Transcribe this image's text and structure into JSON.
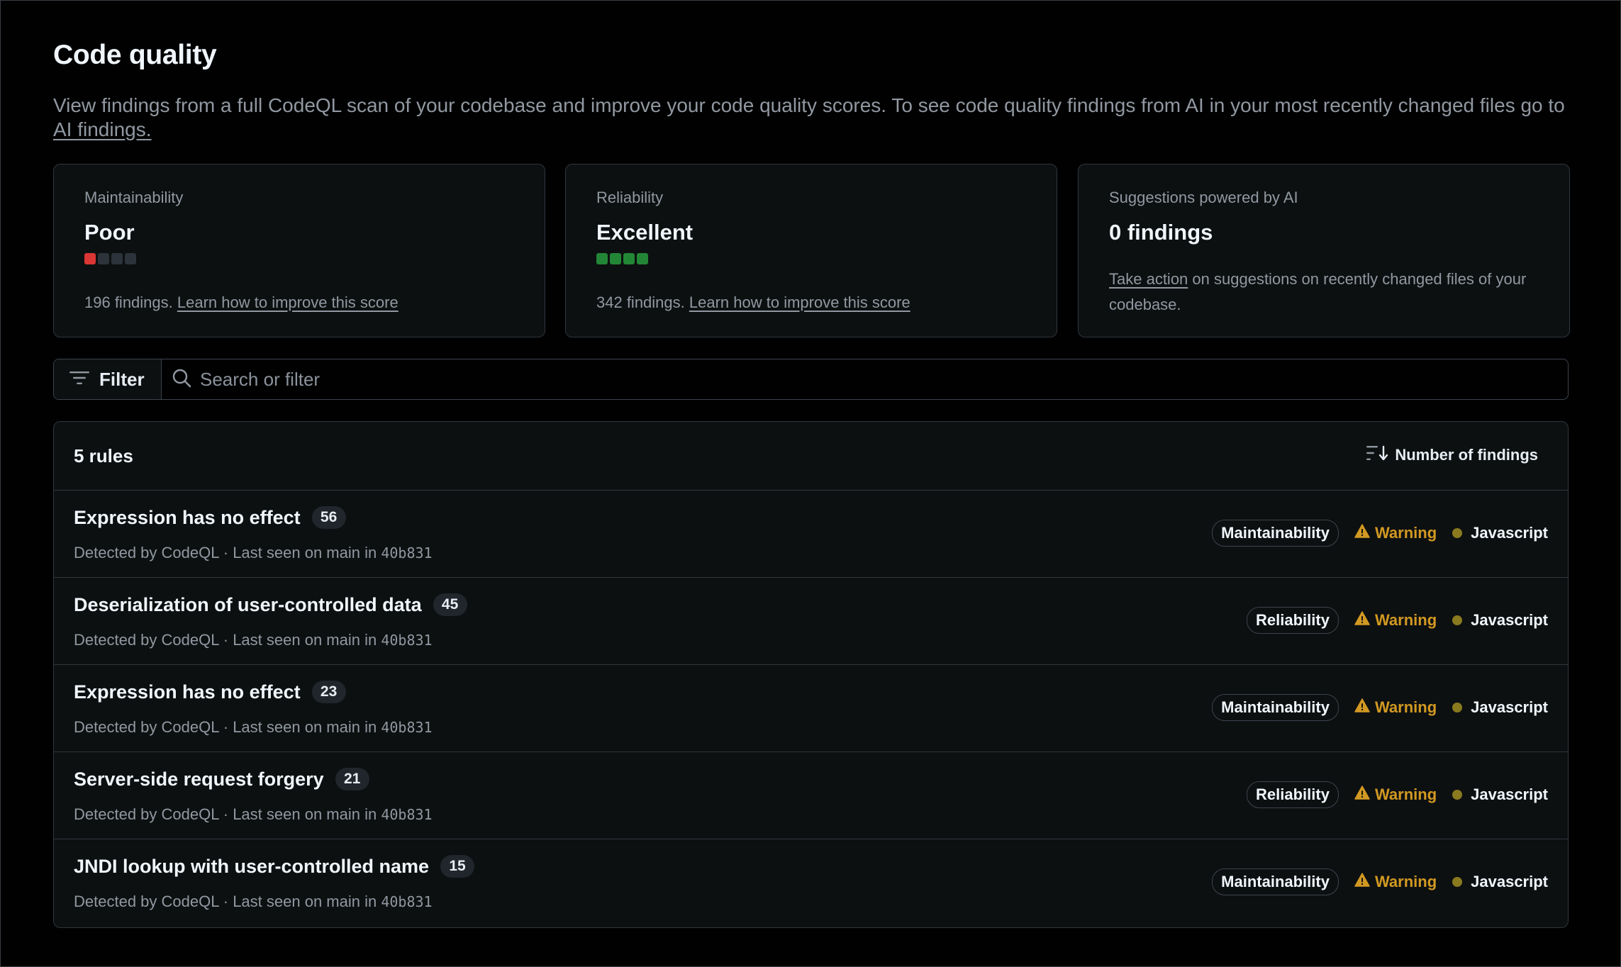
{
  "page": {
    "title": "Code quality",
    "description": "View findings from a full CodeQL scan of your codebase and improve your code quality scores. To see code quality findings from AI in your  most recently changed files go to",
    "description_link": "AI findings."
  },
  "cards": {
    "maintainability": {
      "label": "Maintainability",
      "value": "Poor",
      "score_filled": 1,
      "score_total": 4,
      "fill_color": "#da3633",
      "findings_text": "196 findings.",
      "link": "Learn how to improve this score"
    },
    "reliability": {
      "label": "Reliability",
      "value": "Excellent",
      "score_filled": 4,
      "score_total": 4,
      "fill_color": "#238636",
      "findings_text": "342 findings.",
      "link": "Learn how to improve this score"
    },
    "ai": {
      "label": "Suggestions powered by AI",
      "value": "0 findings",
      "link": "Take action",
      "text": "on suggestions on recently changed files of your codebase."
    }
  },
  "filter": {
    "button_label": "Filter",
    "button_icon": "filter-icon",
    "search_icon": "search-icon",
    "search_placeholder": "Search or filter",
    "search_value": ""
  },
  "rules": {
    "count_label": "5 rules",
    "sort_label": "Number of findings",
    "sort_icon": "sort-descending-icon",
    "meta_prefix": "Detected by CodeQL · Last seen on main in",
    "items": [
      {
        "name": "Expression has no effect",
        "count": "56",
        "category": "Maintainability",
        "severity": "Warning",
        "language": "Javascript",
        "sha": "40b831"
      },
      {
        "name": "Deserialization of user-controlled data",
        "count": "45",
        "category": "Reliability",
        "severity": "Warning",
        "language": "Javascript",
        "sha": "40b831"
      },
      {
        "name": "Expression has no effect",
        "count": "23",
        "category": "Maintainability",
        "severity": "Warning",
        "language": "Javascript",
        "sha": "40b831"
      },
      {
        "name": "Server-side request forgery",
        "count": "21",
        "category": "Reliability",
        "severity": "Warning",
        "language": "Javascript",
        "sha": "40b831"
      },
      {
        "name": "JNDI lookup with user-controlled name",
        "count": "15",
        "category": "Maintainability",
        "severity": "Warning",
        "language": "Javascript",
        "sha": "40b831"
      }
    ]
  },
  "colors": {
    "warning": "#d29922",
    "javascript_dot": "#8a7a1f",
    "empty_score": "#2d333b"
  }
}
